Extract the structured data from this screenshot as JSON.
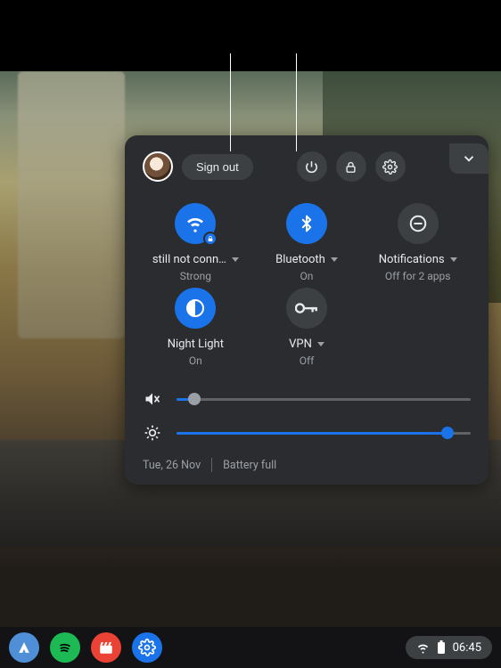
{
  "header": {
    "signout_label": "Sign out"
  },
  "tiles": {
    "wifi": {
      "label": "still not conn…",
      "sub": "Strong",
      "on": true,
      "has_caret": true
    },
    "bluetooth": {
      "label": "Bluetooth",
      "sub": "On",
      "on": true,
      "has_caret": true
    },
    "notifications": {
      "label": "Notifications",
      "sub": "Off for 2 apps",
      "on": false,
      "has_caret": true
    },
    "nightlight": {
      "label": "Night Light",
      "sub": "On",
      "on": true,
      "has_caret": false
    },
    "vpn": {
      "label": "VPN",
      "sub": "Off",
      "on": false,
      "has_caret": true
    }
  },
  "sliders": {
    "volume": {
      "percent": 6,
      "muted": true
    },
    "brightness": {
      "percent": 92
    }
  },
  "footer": {
    "date": "Tue, 26 Nov",
    "battery": "Battery full"
  },
  "tray": {
    "time": "06:45"
  },
  "colors": {
    "accent": "#1a73e8",
    "panel_bg": "#2b2c2f",
    "chip_bg": "#3c4043",
    "text": "#e8eaed",
    "muted": "#9aa0a6"
  },
  "shelf_apps": [
    {
      "name": "nordvpn",
      "bg": "#4e8fd8"
    },
    {
      "name": "spotify",
      "bg": "#1db954"
    },
    {
      "name": "media",
      "bg": "#ea4335"
    },
    {
      "name": "settings",
      "bg": "#1a73e8"
    }
  ]
}
